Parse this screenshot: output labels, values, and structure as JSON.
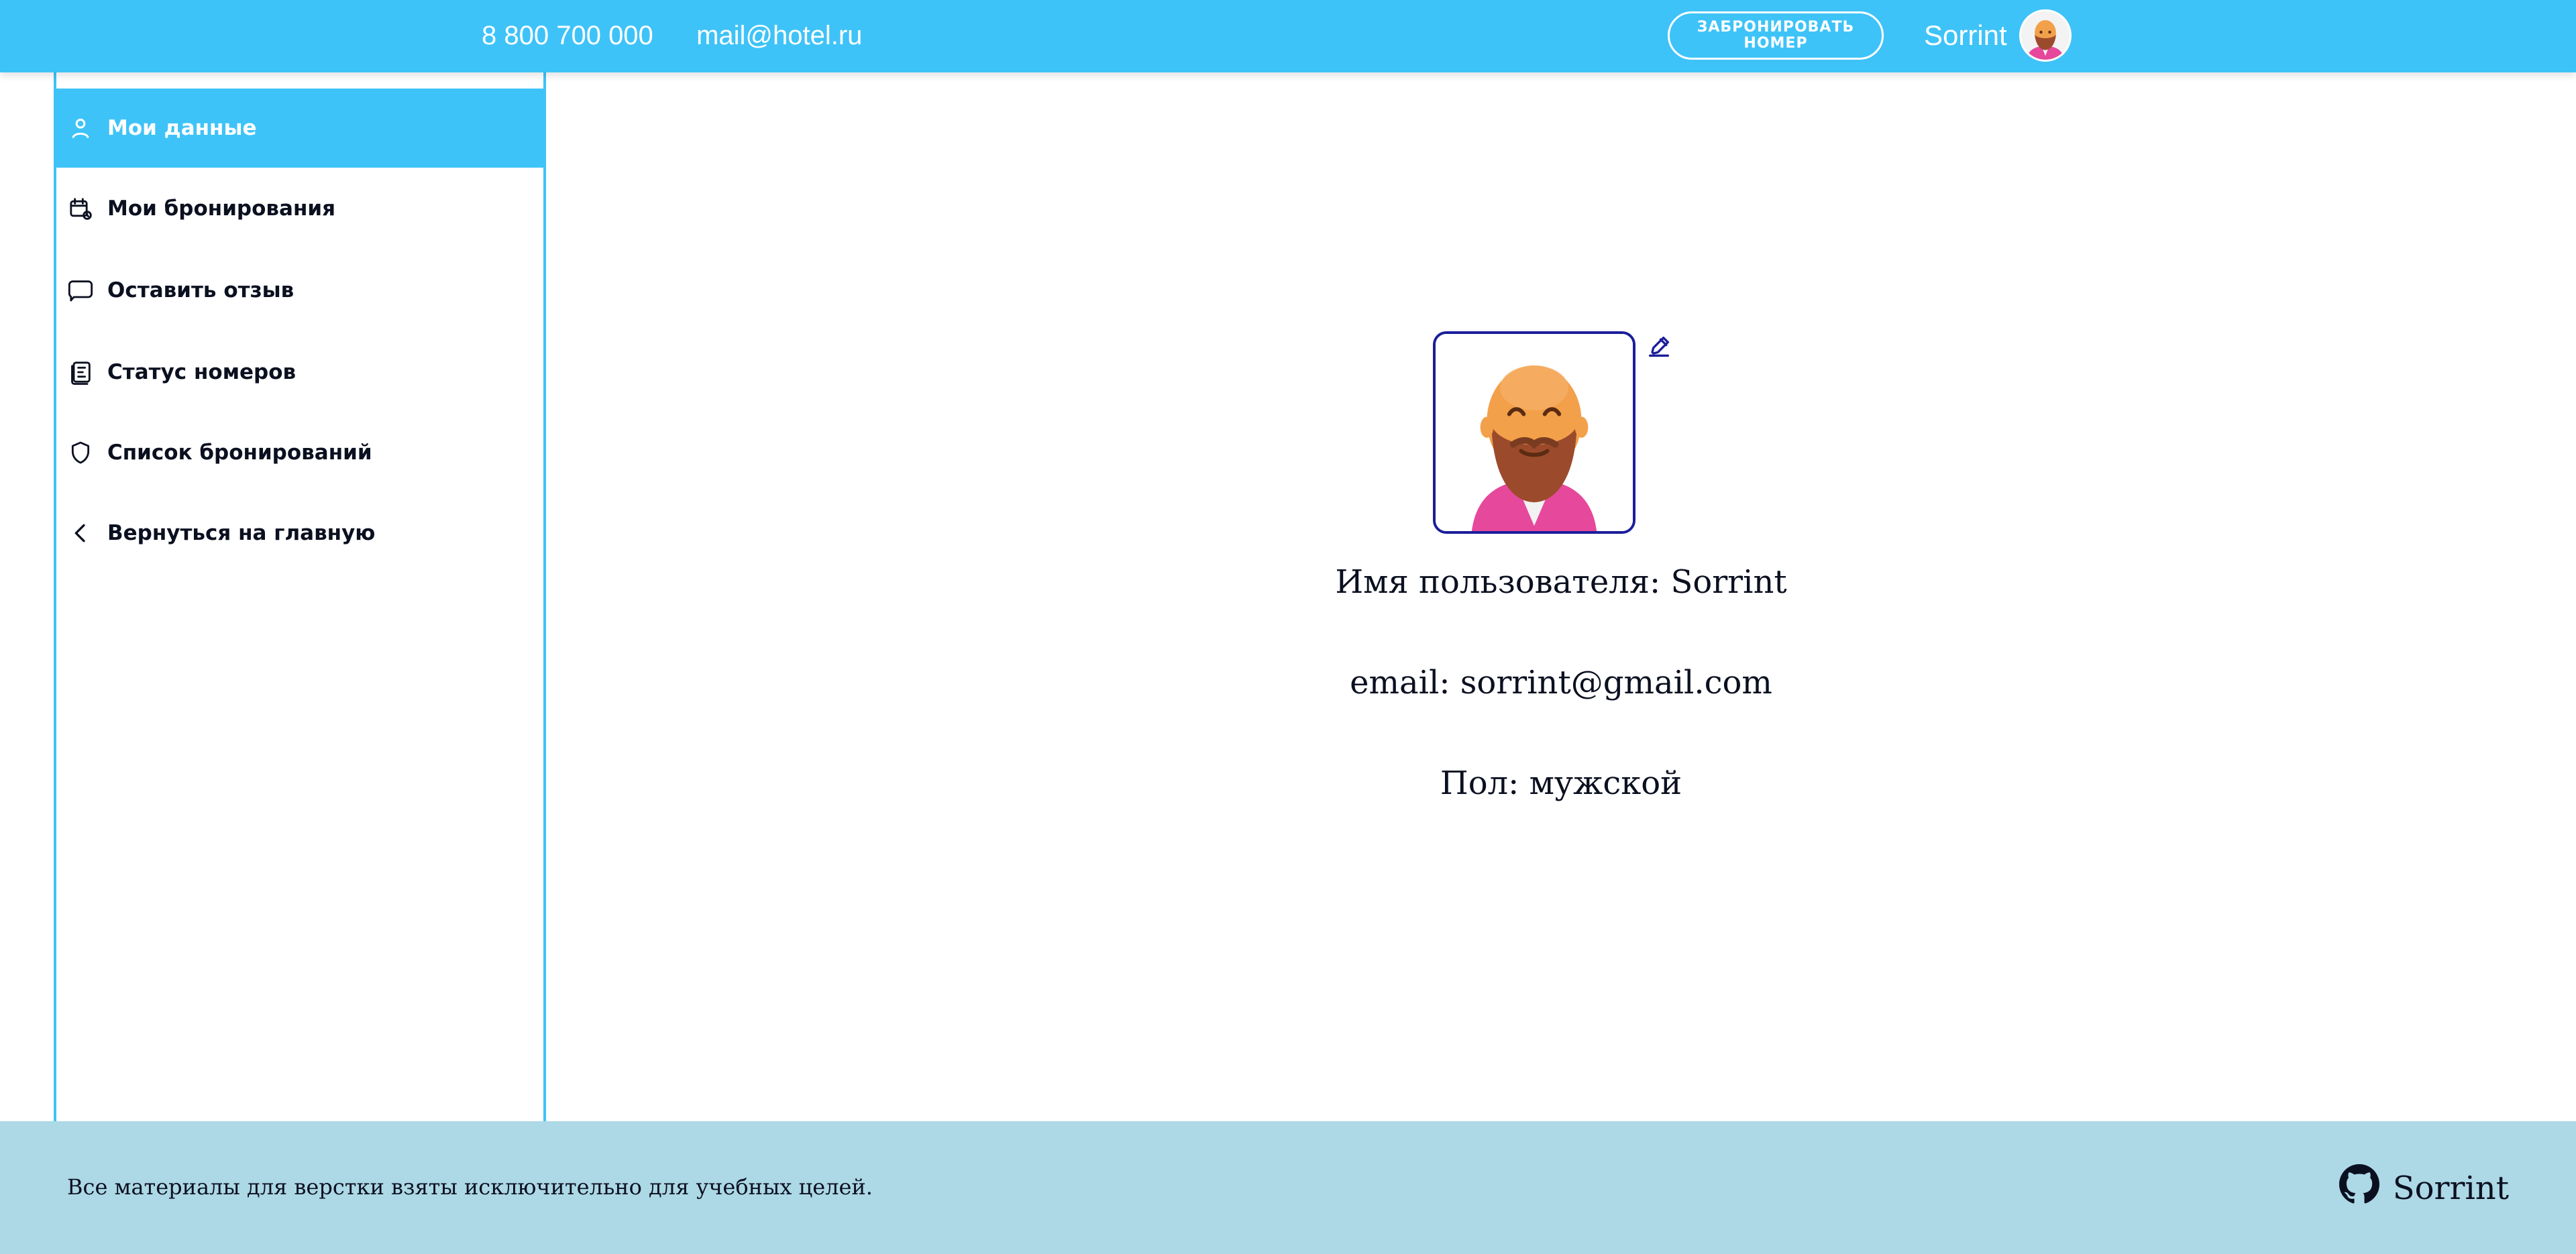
{
  "header": {
    "phone": "8 800 700 000",
    "email": "mail@hotel.ru",
    "book_button_label": "ЗАБРОНИРОВАТЬ НОМЕР",
    "username": "Sorrint",
    "avatar_icon": "bearded-man-avatar-icon",
    "background_color": "#3ec3f8"
  },
  "sidebar": {
    "border_color": "#3ec3f8",
    "items": [
      {
        "label": "Мои данные",
        "icon": "user-icon",
        "active": true
      },
      {
        "label": "Мои бронирования",
        "icon": "calendar-clock-icon",
        "active": false
      },
      {
        "label": "Оставить отзыв",
        "icon": "chat-bubble-icon",
        "active": false
      },
      {
        "label": "Статус номеров",
        "icon": "rooms-status-icon",
        "active": false
      },
      {
        "label": "Список бронирований",
        "icon": "shield-icon",
        "active": false
      },
      {
        "label": "Вернуться на главную",
        "icon": "chevron-left-icon",
        "active": false
      }
    ]
  },
  "profile": {
    "avatar_icon": "bearded-man-avatar-icon",
    "edit_icon": "edit-icon",
    "username_line": "Имя пользователя: Sorrint",
    "email_line": "email: sorrint@gmail.com",
    "gender_line": "Пол: мужской",
    "accent_color": "#1b1e9a"
  },
  "footer": {
    "text": "Все материалы для верстки взяты исключительно для учебных целей.",
    "github_label": "Sorrint",
    "github_icon": "github-icon",
    "background_color": "#add8e6"
  }
}
